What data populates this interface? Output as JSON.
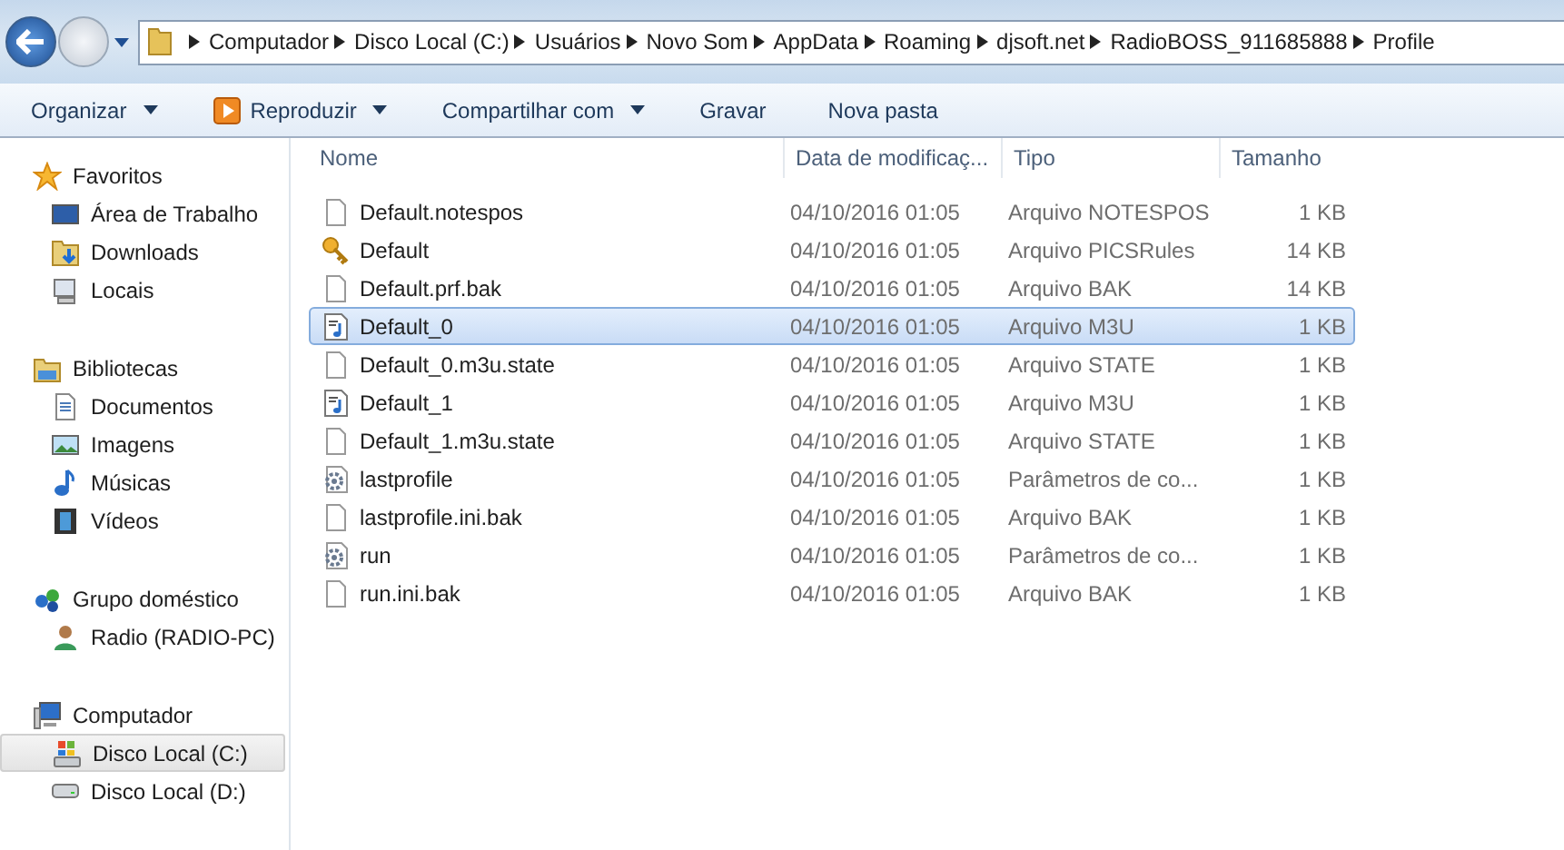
{
  "address_bar": {
    "segments": [
      "Computador",
      "Disco Local (C:)",
      "Usuários",
      "Novo Som",
      "AppData",
      "Roaming",
      "djsoft.net",
      "RadioBOSS_911685888",
      "Profile"
    ]
  },
  "toolbar": [
    {
      "label": "Organizar",
      "dropdown": true
    },
    {
      "label": "Reproduzir",
      "dropdown": true
    },
    {
      "label": "Compartilhar com",
      "dropdown": true
    },
    {
      "label": "Gravar",
      "dropdown": false
    },
    {
      "label": "Nova pasta",
      "dropdown": false
    }
  ],
  "sidebar": {
    "groups": [
      {
        "label": "Favoritos",
        "items": [
          {
            "label": "Área de Trabalho",
            "selected": false
          },
          {
            "label": "Downloads",
            "selected": false
          },
          {
            "label": "Locais",
            "selected": false
          }
        ]
      },
      {
        "label": "Bibliotecas",
        "items": [
          {
            "label": "Documentos",
            "selected": false
          },
          {
            "label": "Imagens",
            "selected": false
          },
          {
            "label": "Músicas",
            "selected": false
          },
          {
            "label": "Vídeos",
            "selected": false
          }
        ]
      },
      {
        "label": "Grupo doméstico",
        "items": [
          {
            "label": "Radio (RADIO-PC)",
            "selected": false
          }
        ]
      },
      {
        "label": "Computador",
        "items": [
          {
            "label": "Disco Local (C:)",
            "selected": true
          },
          {
            "label": "Disco Local (D:)",
            "selected": false
          }
        ]
      }
    ]
  },
  "table": {
    "columns": [
      "Nome",
      "Data de modificaç...",
      "Tipo",
      "Tamanho"
    ],
    "rows": [
      {
        "kind": "file",
        "name": "Default.notespos",
        "date": "04/10/2016 01:05",
        "type": "Arquivo NOTESPOS",
        "size": "1 KB",
        "selected": false
      },
      {
        "kind": "key",
        "name": "Default",
        "date": "04/10/2016 01:05",
        "type": "Arquivo PICSRules",
        "size": "14 KB",
        "selected": false
      },
      {
        "kind": "file",
        "name": "Default.prf.bak",
        "date": "04/10/2016 01:05",
        "type": "Arquivo BAK",
        "size": "14 KB",
        "selected": false
      },
      {
        "kind": "playlist",
        "name": "Default_0",
        "date": "04/10/2016 01:05",
        "type": "Arquivo M3U",
        "size": "1 KB",
        "selected": true
      },
      {
        "kind": "file",
        "name": "Default_0.m3u.state",
        "date": "04/10/2016 01:05",
        "type": "Arquivo STATE",
        "size": "1 KB",
        "selected": false
      },
      {
        "kind": "playlist",
        "name": "Default_1",
        "date": "04/10/2016 01:05",
        "type": "Arquivo M3U",
        "size": "1 KB",
        "selected": false
      },
      {
        "kind": "file",
        "name": "Default_1.m3u.state",
        "date": "04/10/2016 01:05",
        "type": "Arquivo STATE",
        "size": "1 KB",
        "selected": false
      },
      {
        "kind": "settings",
        "name": "lastprofile",
        "date": "04/10/2016 01:05",
        "type": "Parâmetros de co...",
        "size": "1 KB",
        "selected": false
      },
      {
        "kind": "file",
        "name": "lastprofile.ini.bak",
        "date": "04/10/2016 01:05",
        "type": "Arquivo BAK",
        "size": "1 KB",
        "selected": false
      },
      {
        "kind": "settings",
        "name": "run",
        "date": "04/10/2016 01:05",
        "type": "Parâmetros de co...",
        "size": "1 KB",
        "selected": false
      },
      {
        "kind": "file",
        "name": "run.ini.bak",
        "date": "04/10/2016 01:05",
        "type": "Arquivo BAK",
        "size": "1 KB",
        "selected": false
      }
    ]
  }
}
